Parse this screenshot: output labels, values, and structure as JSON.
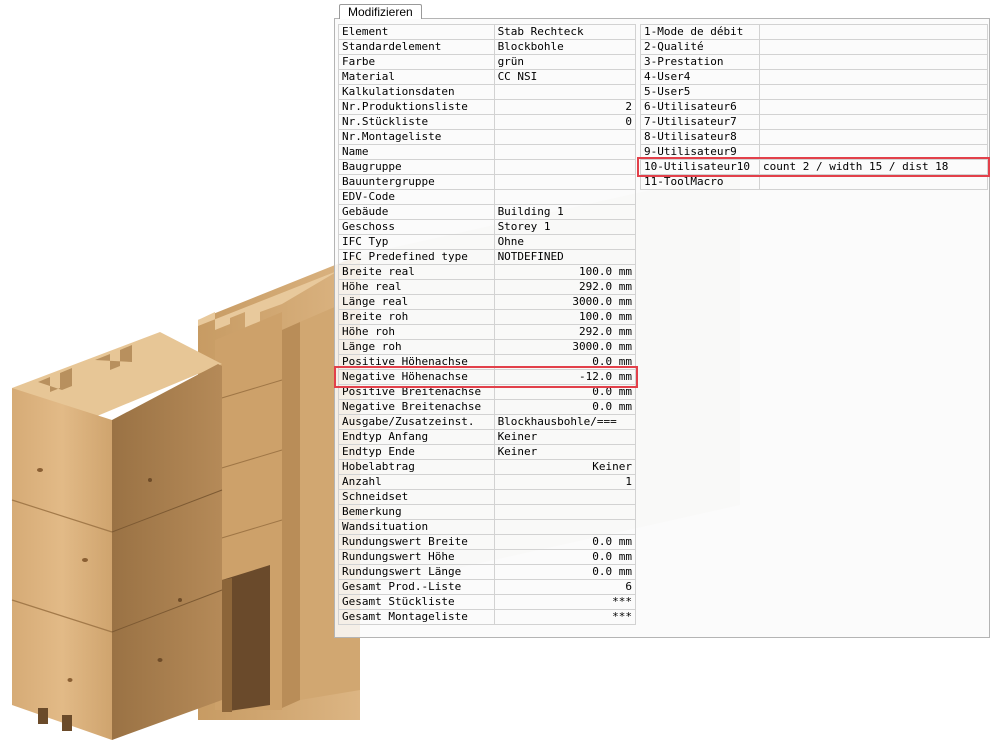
{
  "tab": {
    "label": "Modifizieren"
  },
  "properties": [
    {
      "key": "Element",
      "value": "Stab Rechteck",
      "align": "left"
    },
    {
      "key": "Standardelement",
      "value": "Blockbohle",
      "align": "left"
    },
    {
      "key": "Farbe",
      "value": "grün",
      "align": "left"
    },
    {
      "key": "Material",
      "value": "CC NSI",
      "align": "left"
    },
    {
      "key": "Kalkulationsdaten",
      "value": "",
      "align": "left"
    },
    {
      "key": "Nr.Produktionsliste",
      "value": "2",
      "align": "right"
    },
    {
      "key": "Nr.Stückliste",
      "value": "0",
      "align": "right"
    },
    {
      "key": "Nr.Montageliste",
      "value": "",
      "align": "left"
    },
    {
      "key": "Name",
      "value": "",
      "align": "left"
    },
    {
      "key": "Baugruppe",
      "value": "",
      "align": "left"
    },
    {
      "key": "Bauuntergruppe",
      "value": "",
      "align": "left"
    },
    {
      "key": "EDV-Code",
      "value": "",
      "align": "left"
    },
    {
      "key": "Gebäude",
      "value": "Building 1",
      "align": "left"
    },
    {
      "key": "Geschoss",
      "value": "Storey 1",
      "align": "left"
    },
    {
      "key": "IFC Typ",
      "value": "Ohne",
      "align": "left"
    },
    {
      "key": "IFC Predefined type",
      "value": "NOTDEFINED",
      "align": "left"
    },
    {
      "key": "Breite real",
      "value": "100.0 mm",
      "align": "right"
    },
    {
      "key": "Höhe real",
      "value": "292.0 mm",
      "align": "right"
    },
    {
      "key": "Länge real",
      "value": "3000.0 mm",
      "align": "right"
    },
    {
      "key": "Breite roh",
      "value": "100.0 mm",
      "align": "right"
    },
    {
      "key": "Höhe roh",
      "value": "292.0 mm",
      "align": "right"
    },
    {
      "key": "Länge roh",
      "value": "3000.0 mm",
      "align": "right"
    },
    {
      "key": "Positive Höhenachse",
      "value": "0.0 mm",
      "align": "right"
    },
    {
      "key": "Negative Höhenachse",
      "value": "-12.0 mm",
      "align": "right"
    },
    {
      "key": "Positive Breitenachse",
      "value": "0.0 mm",
      "align": "right"
    },
    {
      "key": "Negative Breitenachse",
      "value": "0.0 mm",
      "align": "right"
    },
    {
      "key": "Ausgabe/Zusatzeinst.",
      "value": "Blockhausbohle/===",
      "align": "left"
    },
    {
      "key": "Endtyp Anfang",
      "value": "Keiner",
      "align": "left"
    },
    {
      "key": "Endtyp Ende",
      "value": "Keiner",
      "align": "left"
    },
    {
      "key": "Hobelabtrag",
      "value": "Keiner",
      "align": "right"
    },
    {
      "key": "Anzahl",
      "value": "1",
      "align": "right"
    },
    {
      "key": "Schneidset",
      "value": "",
      "align": "left"
    },
    {
      "key": "Bemerkung",
      "value": "",
      "align": "left"
    },
    {
      "key": "Wandsituation",
      "value": "",
      "align": "left"
    },
    {
      "key": "Rundungswert Breite",
      "value": "0.0 mm",
      "align": "right"
    },
    {
      "key": "Rundungswert Höhe",
      "value": "0.0 mm",
      "align": "right"
    },
    {
      "key": "Rundungswert Länge",
      "value": "0.0 mm",
      "align": "right"
    },
    {
      "key": "Gesamt Prod.-Liste",
      "value": "6",
      "align": "right"
    },
    {
      "key": "Gesamt Stückliste",
      "value": "***",
      "align": "right"
    },
    {
      "key": "Gesamt Montageliste",
      "value": "***",
      "align": "right"
    }
  ],
  "user_attributes": [
    {
      "key": "1-Mode de débit",
      "value": ""
    },
    {
      "key": "2-Qualité",
      "value": ""
    },
    {
      "key": "3-Prestation",
      "value": ""
    },
    {
      "key": "4-User4",
      "value": ""
    },
    {
      "key": "5-User5",
      "value": ""
    },
    {
      "key": "6-Utilisateur6",
      "value": ""
    },
    {
      "key": "7-Utilisateur7",
      "value": ""
    },
    {
      "key": "8-Utilisateur8",
      "value": ""
    },
    {
      "key": "9-Utilisateur9",
      "value": ""
    },
    {
      "key": "10-Utilisateur10",
      "value": "count 2 / width 15 / dist 18"
    },
    {
      "key": "11-ToolMacro",
      "value": ""
    }
  ],
  "colors": {
    "highlight": "#e2404a",
    "wood_front": "#d9b07c",
    "wood_side": "#a47c4d",
    "wood_top": "#e6c79c"
  }
}
